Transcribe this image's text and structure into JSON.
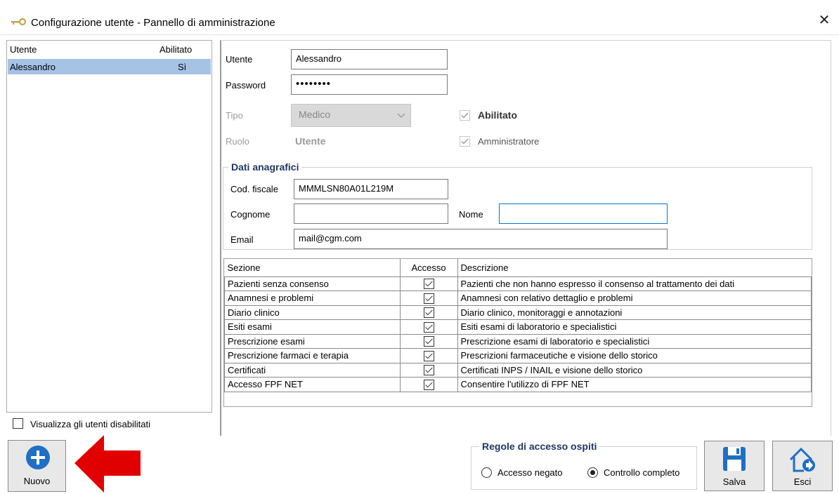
{
  "window": {
    "title": "Configurazione utente - Pannello di amministrazione",
    "close_glyph": "✕"
  },
  "users_list": {
    "col_user": "Utente",
    "col_enabled": "Abilitato",
    "rows": [
      {
        "user": "Alessandro",
        "enabled": "Sì"
      }
    ]
  },
  "show_disabled_label": "Visualizza gli utenti disabilitati",
  "form": {
    "user_label": "Utente",
    "user_value": "Alessandro",
    "password_label": "Password",
    "password_value": "••••••••",
    "tipo_label": "Tipo",
    "tipo_value": "Medico",
    "ruolo_label": "Ruolo",
    "ruolo_value": "Utente",
    "abilitato_label": "Abilitato",
    "amministratore_label": "Amministratore"
  },
  "anagrafica": {
    "title": "Dati anagrafici",
    "cf_label": "Cod. fiscale",
    "cf_value": "MMMLSN80A01L219M",
    "cognome_label": "Cognome",
    "cognome_value": "",
    "nome_label": "Nome",
    "nome_value": "",
    "email_label": "Email",
    "email_value": "mail@cgm.com"
  },
  "sections": {
    "headers": [
      "Sezione",
      "Accesso",
      "Descrizione"
    ],
    "rows": [
      {
        "section": "Pazienti senza consenso",
        "access": true,
        "description": "Pazienti che non hanno espresso il consenso al trattamento dei dati"
      },
      {
        "section": "Anamnesi e problemi",
        "access": true,
        "description": "Anamnesi con relativo dettaglio e problemi"
      },
      {
        "section": "Diario clinico",
        "access": true,
        "description": "Diario clinico, monitoraggi e annotazioni"
      },
      {
        "section": "Esiti esami",
        "access": true,
        "description": "Esiti esami di laboratorio e specialistici"
      },
      {
        "section": "Prescrizione esami",
        "access": true,
        "description": "Prescrizione esami di laboratorio e specialistici"
      },
      {
        "section": "Prescrizione farmaci e terapia",
        "access": true,
        "description": "Prescrizioni farmaceutiche e visione dello storico"
      },
      {
        "section": "Certificati",
        "access": true,
        "description": "Certificati INPS / INAIL e visione dello storico"
      },
      {
        "section": "Accesso FPF NET",
        "access": true,
        "description": "Consentire l'utilizzo di FPF NET"
      }
    ]
  },
  "guest_rules": {
    "title": "Regole di accesso ospiti",
    "option_denied": "Accesso negato",
    "option_full": "Controllo completo",
    "selected": "Controllo completo"
  },
  "buttons": {
    "new": "Nuovo",
    "save": "Salva",
    "exit": "Esci"
  },
  "colors": {
    "selection": "#a6c3e6",
    "accent": "#1f6fc5",
    "arrow": "#e00000",
    "group_title": "#1f3864"
  }
}
